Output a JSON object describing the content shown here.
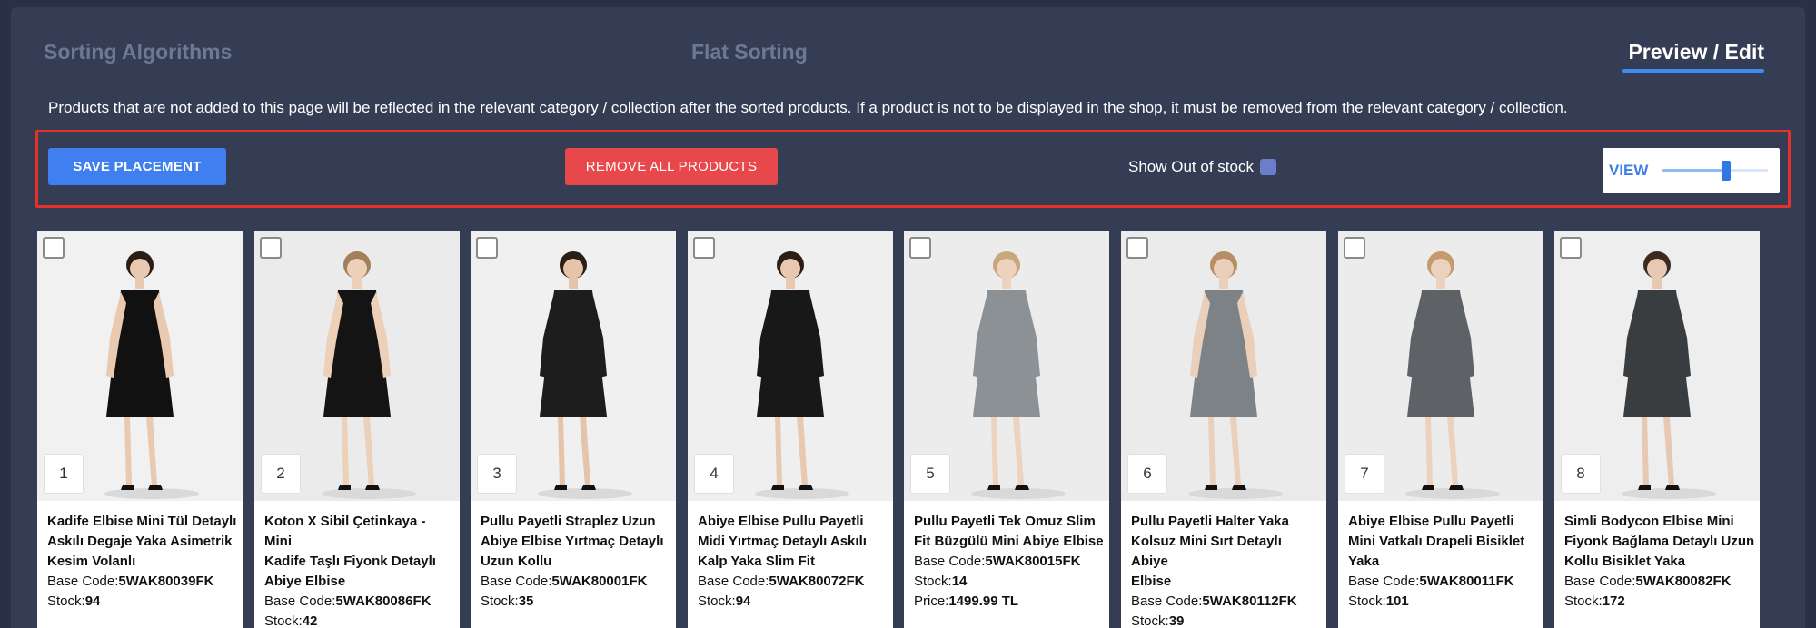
{
  "tabs": [
    {
      "label": "Sorting Algorithms"
    },
    {
      "label": "Flat Sorting"
    },
    {
      "label": "Preview / Edit"
    }
  ],
  "info_text": "Products that are not added to this page will be reflected in the relevant category / collection after the sorted products. If a product is not to be displayed in the shop, it must be removed from the relevant category / collection.",
  "toolbar": {
    "save_label": "SAVE PLACEMENT",
    "remove_label": "REMOVE ALL PRODUCTS",
    "out_of_stock_label": "Show Out of stock",
    "view_label": "VIEW",
    "view_level": 0.6
  },
  "field_labels": {
    "base_code": "Base Code:",
    "stock": "Stock:",
    "price": "Price:"
  },
  "colors": {
    "background": "#2a3146",
    "panel": "#353d55",
    "accent": "#3f7ff0",
    "danger": "#e8484b",
    "highlight_border": "#e4322b"
  },
  "products": [
    {
      "rank": "1",
      "name_lines": [
        "Kadife Elbise Mini Tül Detaylı",
        "Askılı Degaje Yaka Asimetrik",
        "Kesim Volanlı"
      ],
      "base_code": "5WAK80039FK",
      "stock": "94",
      "price": "",
      "dress": "#111111",
      "skin": "#e9c9b0",
      "hair": "#2a1d16",
      "bg": "#f1f1f1"
    },
    {
      "rank": "2",
      "name_lines": [
        "Koton X Sibil Çetinkaya - Mini",
        "Kadife Taşlı Fiyonk Detaylı",
        "Abiye Elbise"
      ],
      "base_code": "5WAK80086FK",
      "stock": "42",
      "price": "",
      "dress": "#141414",
      "skin": "#ecd0b8",
      "hair": "#a37f5a",
      "bg": "#ebebeb"
    },
    {
      "rank": "3",
      "name_lines": [
        "Pullu Payetli Straplez Uzun",
        "Abiye Elbise Yırtmaç Detaylı",
        "Uzun Kollu"
      ],
      "base_code": "5WAK80001FK",
      "stock": "35",
      "price": "",
      "dress": "#1d1d1d",
      "skin": "#e6c4aa",
      "hair": "#2b1e17",
      "bg": "#f0f0f0"
    },
    {
      "rank": "4",
      "name_lines": [
        "Abiye Elbise Pullu Payetli",
        "Midi Yırtmaç Detaylı Askılı",
        "Kalp Yaka Slim Fit"
      ],
      "base_code": "5WAK80072FK",
      "stock": "94",
      "price": "",
      "dress": "#181818",
      "skin": "#e8c8ae",
      "hair": "#2b1e17",
      "bg": "#efefef"
    },
    {
      "rank": "5",
      "name_lines": [
        "Pullu Payetli Tek Omuz Slim",
        "Fit Büzgülü Mini Abiye Elbise"
      ],
      "base_code": "5WAK80015FK",
      "stock": "14",
      "price": "1499.99 TL",
      "dress": "#8c9196",
      "skin": "#edd2bd",
      "hair": "#c9a77c",
      "bg": "#ececec"
    },
    {
      "rank": "6",
      "name_lines": [
        "Pullu Payetli Halter Yaka",
        "Kolsuz Mini Sırt Detaylı Abiye",
        "Elbise"
      ],
      "base_code": "5WAK80112FK",
      "stock": "39",
      "price": "",
      "dress": "#7d8287",
      "skin": "#ead0bb",
      "hair": "#b88f64",
      "bg": "#ebebeb"
    },
    {
      "rank": "7",
      "name_lines": [
        "Abiye Elbise Pullu Payetli",
        "Mini Vatkalı Drapeli Bisiklet",
        "Yaka"
      ],
      "base_code": "5WAK80011FK",
      "stock": "101",
      "price": "",
      "dress": "#5e6266",
      "skin": "#ecd2be",
      "hair": "#c49b6c",
      "bg": "#ececec"
    },
    {
      "rank": "8",
      "name_lines": [
        "Simli Bodycon Elbise Mini",
        "Fiyonk Bağlama Detaylı Uzun",
        "Kollu Bisiklet Yaka"
      ],
      "base_code": "5WAK80082FK",
      "stock": "172",
      "price": "",
      "dress": "#3a3d40",
      "skin": "#e7c9b3",
      "hair": "#3a2a1f",
      "bg": "#eeeeee"
    }
  ]
}
